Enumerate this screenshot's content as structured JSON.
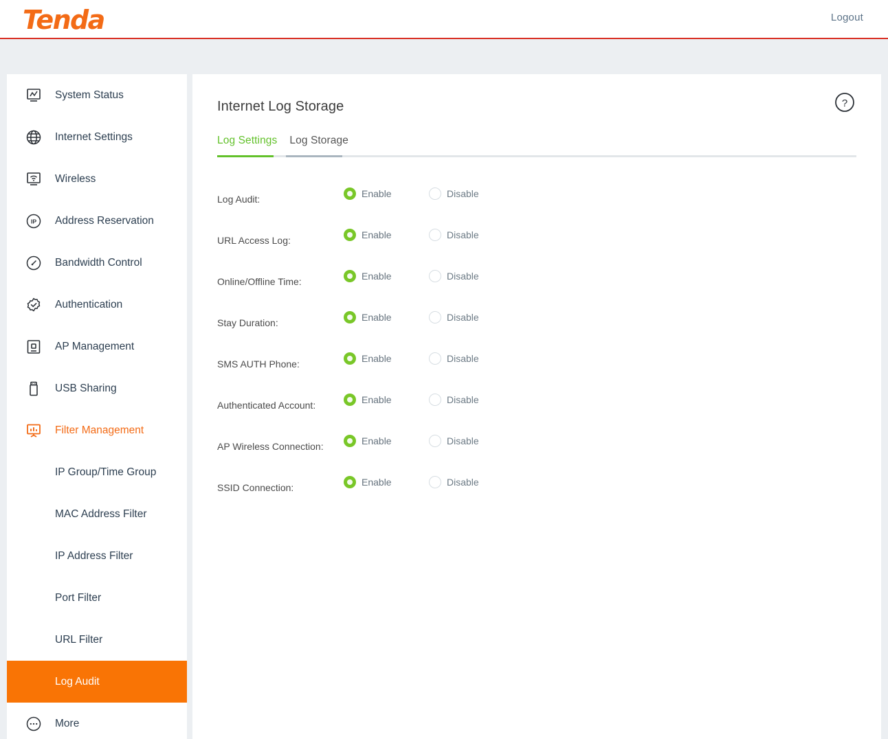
{
  "header": {
    "logo_text": "Tenda",
    "logout_label": "Logout",
    "logo_color": "#f36b16",
    "accent_red": "#d93025"
  },
  "sidebar": {
    "items": [
      {
        "label": "System Status",
        "icon": "monitor-chart-icon",
        "type": "top",
        "state": "normal"
      },
      {
        "label": "Internet Settings",
        "icon": "globe-icon",
        "type": "top",
        "state": "normal"
      },
      {
        "label": "Wireless",
        "icon": "monitor-wifi-icon",
        "type": "top",
        "state": "normal"
      },
      {
        "label": "Address Reservation",
        "icon": "ip-circle-icon",
        "type": "top",
        "state": "normal"
      },
      {
        "label": "Bandwidth Control",
        "icon": "gauge-icon",
        "type": "top",
        "state": "normal"
      },
      {
        "label": "Authentication",
        "icon": "badge-check-icon",
        "type": "top",
        "state": "normal"
      },
      {
        "label": "AP Management",
        "icon": "ap-device-icon",
        "type": "top",
        "state": "normal"
      },
      {
        "label": "USB Sharing",
        "icon": "usb-drive-icon",
        "type": "top",
        "state": "normal"
      },
      {
        "label": "Filter Management",
        "icon": "filter-board-icon",
        "type": "top",
        "state": "expanded"
      },
      {
        "label": "IP Group/Time Group",
        "icon": "",
        "type": "sub",
        "state": "normal"
      },
      {
        "label": "MAC Address Filter",
        "icon": "",
        "type": "sub",
        "state": "normal"
      },
      {
        "label": "IP Address Filter",
        "icon": "",
        "type": "sub",
        "state": "normal"
      },
      {
        "label": "Port Filter",
        "icon": "",
        "type": "sub",
        "state": "normal"
      },
      {
        "label": "URL Filter",
        "icon": "",
        "type": "sub",
        "state": "normal"
      },
      {
        "label": "Log Audit",
        "icon": "",
        "type": "sub",
        "state": "selected"
      },
      {
        "label": "More",
        "icon": "more-dots-icon",
        "type": "top",
        "state": "normal"
      }
    ],
    "selected_color": "#f97405",
    "expanded_color": "#f36b16"
  },
  "main": {
    "title": "Internet Log Storage",
    "help_icon": "question-circle-icon",
    "tabs": [
      {
        "label": "Log Settings",
        "active": true
      },
      {
        "label": "Log Storage",
        "active": false
      }
    ],
    "active_tab_color": "#62c12a",
    "rows": [
      {
        "label": "Log Audit:",
        "enable_label": "Enable",
        "disable_label": "Disable",
        "value": "enable"
      },
      {
        "label": "URL Access Log:",
        "enable_label": "Enable",
        "disable_label": "Disable",
        "value": "enable"
      },
      {
        "label": "Online/Offline Time:",
        "enable_label": "Enable",
        "disable_label": "Disable",
        "value": "enable"
      },
      {
        "label": "Stay Duration:",
        "enable_label": "Enable",
        "disable_label": "Disable",
        "value": "enable"
      },
      {
        "label": "SMS AUTH Phone:",
        "enable_label": "Enable",
        "disable_label": "Disable",
        "value": "enable"
      },
      {
        "label": "Authenticated Account:",
        "enable_label": "Enable",
        "disable_label": "Disable",
        "value": "enable"
      },
      {
        "label": "AP Wireless Connection:",
        "enable_label": "Enable",
        "disable_label": "Disable",
        "value": "enable"
      },
      {
        "label": "SSID Connection:",
        "enable_label": "Enable",
        "disable_label": "Disable",
        "value": "enable"
      }
    ],
    "radio_on_color": "#79c728",
    "radio_off_color": "#d6dde2"
  }
}
